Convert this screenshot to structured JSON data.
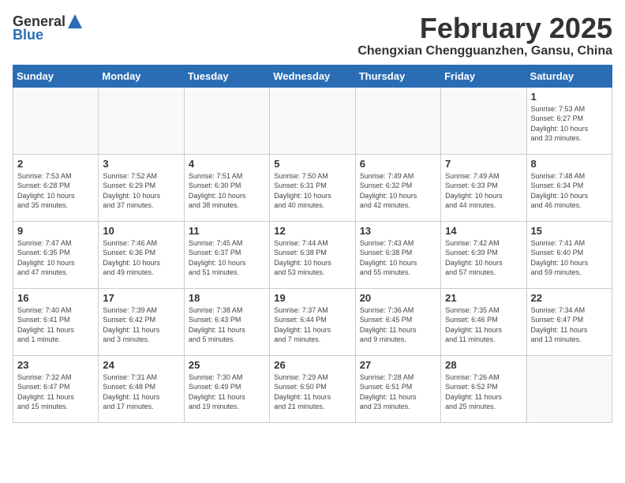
{
  "header": {
    "logo_general": "General",
    "logo_blue": "Blue",
    "month_year": "February 2025",
    "location": "Chengxian Chengguanzhen, Gansu, China"
  },
  "weekdays": [
    "Sunday",
    "Monday",
    "Tuesday",
    "Wednesday",
    "Thursday",
    "Friday",
    "Saturday"
  ],
  "weeks": [
    [
      {
        "day": "",
        "info": ""
      },
      {
        "day": "",
        "info": ""
      },
      {
        "day": "",
        "info": ""
      },
      {
        "day": "",
        "info": ""
      },
      {
        "day": "",
        "info": ""
      },
      {
        "day": "",
        "info": ""
      },
      {
        "day": "1",
        "info": "Sunrise: 7:53 AM\nSunset: 6:27 PM\nDaylight: 10 hours\nand 33 minutes."
      }
    ],
    [
      {
        "day": "2",
        "info": "Sunrise: 7:53 AM\nSunset: 6:28 PM\nDaylight: 10 hours\nand 35 minutes."
      },
      {
        "day": "3",
        "info": "Sunrise: 7:52 AM\nSunset: 6:29 PM\nDaylight: 10 hours\nand 37 minutes."
      },
      {
        "day": "4",
        "info": "Sunrise: 7:51 AM\nSunset: 6:30 PM\nDaylight: 10 hours\nand 38 minutes."
      },
      {
        "day": "5",
        "info": "Sunrise: 7:50 AM\nSunset: 6:31 PM\nDaylight: 10 hours\nand 40 minutes."
      },
      {
        "day": "6",
        "info": "Sunrise: 7:49 AM\nSunset: 6:32 PM\nDaylight: 10 hours\nand 42 minutes."
      },
      {
        "day": "7",
        "info": "Sunrise: 7:49 AM\nSunset: 6:33 PM\nDaylight: 10 hours\nand 44 minutes."
      },
      {
        "day": "8",
        "info": "Sunrise: 7:48 AM\nSunset: 6:34 PM\nDaylight: 10 hours\nand 46 minutes."
      }
    ],
    [
      {
        "day": "9",
        "info": "Sunrise: 7:47 AM\nSunset: 6:35 PM\nDaylight: 10 hours\nand 47 minutes."
      },
      {
        "day": "10",
        "info": "Sunrise: 7:46 AM\nSunset: 6:36 PM\nDaylight: 10 hours\nand 49 minutes."
      },
      {
        "day": "11",
        "info": "Sunrise: 7:45 AM\nSunset: 6:37 PM\nDaylight: 10 hours\nand 51 minutes."
      },
      {
        "day": "12",
        "info": "Sunrise: 7:44 AM\nSunset: 6:38 PM\nDaylight: 10 hours\nand 53 minutes."
      },
      {
        "day": "13",
        "info": "Sunrise: 7:43 AM\nSunset: 6:38 PM\nDaylight: 10 hours\nand 55 minutes."
      },
      {
        "day": "14",
        "info": "Sunrise: 7:42 AM\nSunset: 6:39 PM\nDaylight: 10 hours\nand 57 minutes."
      },
      {
        "day": "15",
        "info": "Sunrise: 7:41 AM\nSunset: 6:40 PM\nDaylight: 10 hours\nand 59 minutes."
      }
    ],
    [
      {
        "day": "16",
        "info": "Sunrise: 7:40 AM\nSunset: 6:41 PM\nDaylight: 11 hours\nand 1 minute."
      },
      {
        "day": "17",
        "info": "Sunrise: 7:39 AM\nSunset: 6:42 PM\nDaylight: 11 hours\nand 3 minutes."
      },
      {
        "day": "18",
        "info": "Sunrise: 7:38 AM\nSunset: 6:43 PM\nDaylight: 11 hours\nand 5 minutes."
      },
      {
        "day": "19",
        "info": "Sunrise: 7:37 AM\nSunset: 6:44 PM\nDaylight: 11 hours\nand 7 minutes."
      },
      {
        "day": "20",
        "info": "Sunrise: 7:36 AM\nSunset: 6:45 PM\nDaylight: 11 hours\nand 9 minutes."
      },
      {
        "day": "21",
        "info": "Sunrise: 7:35 AM\nSunset: 6:46 PM\nDaylight: 11 hours\nand 11 minutes."
      },
      {
        "day": "22",
        "info": "Sunrise: 7:34 AM\nSunset: 6:47 PM\nDaylight: 11 hours\nand 13 minutes."
      }
    ],
    [
      {
        "day": "23",
        "info": "Sunrise: 7:32 AM\nSunset: 6:47 PM\nDaylight: 11 hours\nand 15 minutes."
      },
      {
        "day": "24",
        "info": "Sunrise: 7:31 AM\nSunset: 6:48 PM\nDaylight: 11 hours\nand 17 minutes."
      },
      {
        "day": "25",
        "info": "Sunrise: 7:30 AM\nSunset: 6:49 PM\nDaylight: 11 hours\nand 19 minutes."
      },
      {
        "day": "26",
        "info": "Sunrise: 7:29 AM\nSunset: 6:50 PM\nDaylight: 11 hours\nand 21 minutes."
      },
      {
        "day": "27",
        "info": "Sunrise: 7:28 AM\nSunset: 6:51 PM\nDaylight: 11 hours\nand 23 minutes."
      },
      {
        "day": "28",
        "info": "Sunrise: 7:26 AM\nSunset: 6:52 PM\nDaylight: 11 hours\nand 25 minutes."
      },
      {
        "day": "",
        "info": ""
      }
    ]
  ]
}
